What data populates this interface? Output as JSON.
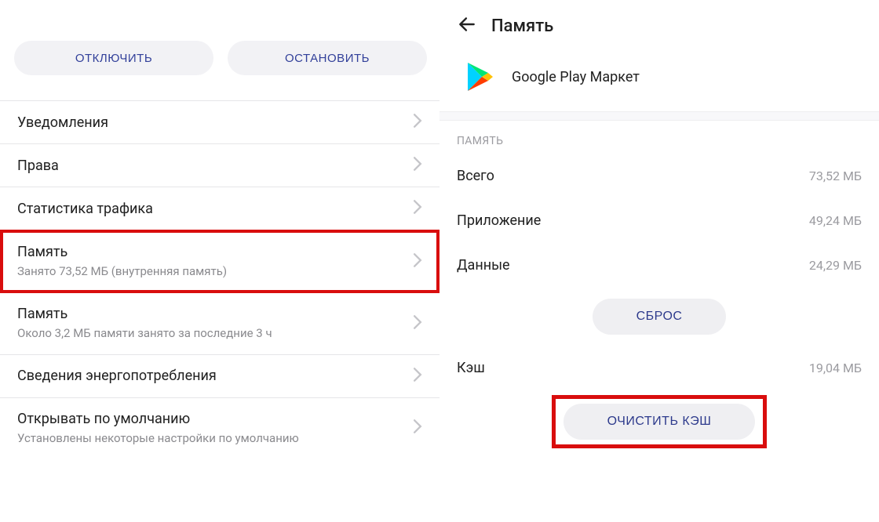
{
  "left": {
    "buttons": {
      "disable": "ОТКЛЮЧИТЬ",
      "stop": "ОСТАНОВИТЬ"
    },
    "rows": {
      "notifications": {
        "title": "Уведомления"
      },
      "permissions": {
        "title": "Права"
      },
      "traffic": {
        "title": "Статистика трафика"
      },
      "storage_highlighted": {
        "title": "Память",
        "subtitle": "Занято 73,52 МБ (внутренняя память)"
      },
      "storage_recent": {
        "title": "Память",
        "subtitle": "Около 3,2 МБ памяти занято за последние 3 ч"
      },
      "power": {
        "title": "Сведения энергопотребления"
      },
      "open_default": {
        "title": "Открывать по умолчанию",
        "subtitle": "Установлены некоторые настройки по умолчанию"
      }
    }
  },
  "right": {
    "header_title": "Память",
    "app_name": "Google Play Маркет",
    "section_label": "ПАМЯТЬ",
    "stats": {
      "total": {
        "label": "Всего",
        "value": "73,52 МБ"
      },
      "app": {
        "label": "Приложение",
        "value": "49,24 МБ"
      },
      "data": {
        "label": "Данные",
        "value": "24,29 МБ"
      },
      "cache": {
        "label": "Кэш",
        "value": "19,04 МБ"
      }
    },
    "buttons": {
      "reset": "СБРОС",
      "clear_cache": "ОЧИСТИТЬ КЭШ"
    }
  }
}
